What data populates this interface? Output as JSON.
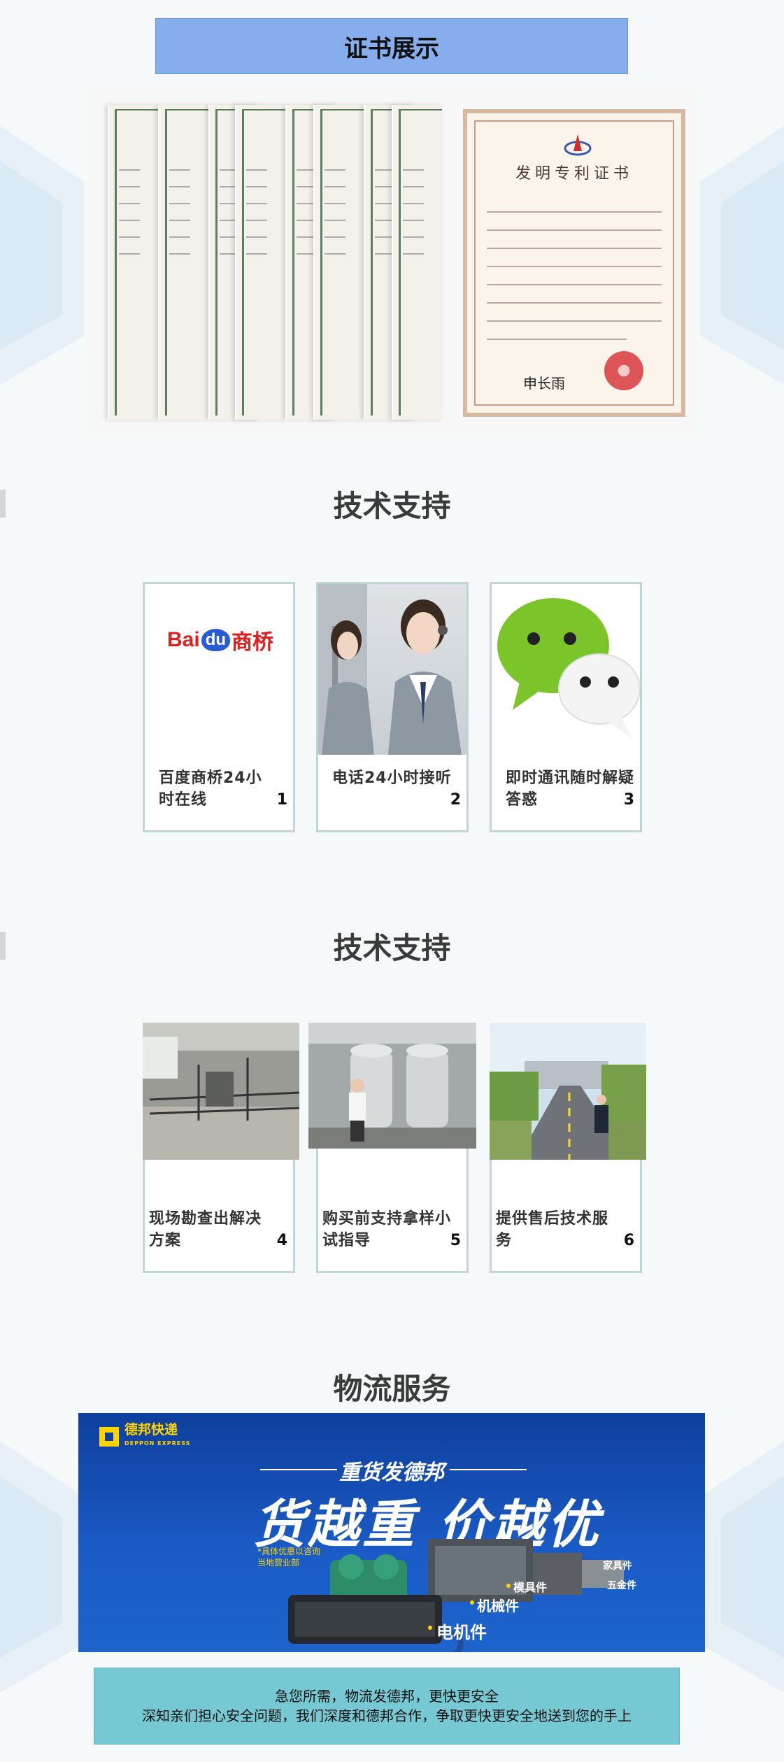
{
  "certificates": {
    "header": "证书展示",
    "main_certificate_title": "发明专利证书",
    "signature": "申长雨"
  },
  "tech_support_1": {
    "title": "技术支持",
    "cards": [
      {
        "label": "百度商桥24小时在线",
        "number": "1",
        "logo_text_a": "Bai",
        "logo_text_b": "du",
        "logo_text_c": "商桥"
      },
      {
        "label": "电话24小时接听",
        "number": "2"
      },
      {
        "label": "即时通讯随时解疑答惑",
        "number": "3"
      }
    ]
  },
  "tech_support_2": {
    "title": "技术支持",
    "cards": [
      {
        "label": "现场勘查出解决方案",
        "number": "4"
      },
      {
        "label": "购买前支持拿样小试指导",
        "number": "5"
      },
      {
        "label": "提供售后技术服务",
        "number": "6"
      }
    ]
  },
  "logistics": {
    "title": "物流服务",
    "brand": "德邦快递",
    "brand_en": "DEPPON EXPRESS",
    "slogan_small": "重货发德邦",
    "slogan_big": "货越重 价越优",
    "note_line1": "*具体优惠以咨询",
    "note_line2": "当地营业部",
    "labels": [
      "家具件",
      "五金件",
      "模具件",
      "机械件",
      "电机件"
    ],
    "accent_color": "#ffd400"
  },
  "footer": {
    "line1": "急您所需，物流发德邦，更快更安全",
    "line2": "深知亲们担心安全问题，我们深度和德邦合作，争取更快更安全地送到您的手上"
  }
}
